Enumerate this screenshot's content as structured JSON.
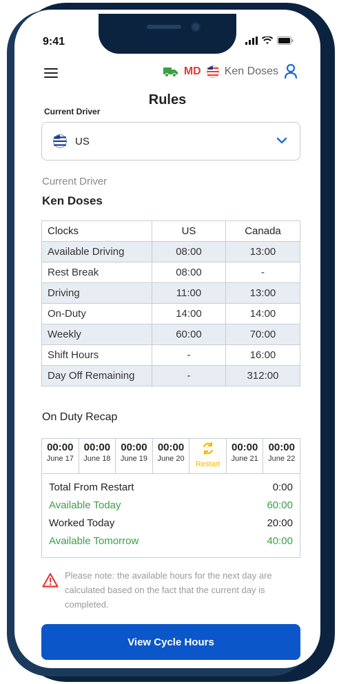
{
  "status_bar": {
    "time": "9:41"
  },
  "header": {
    "md_label": "MD",
    "driver_name": "Ken Doses",
    "title": "Rules"
  },
  "current_driver_label": "Current Driver",
  "select": {
    "value": "US"
  },
  "driver_section": {
    "label": "Current Driver",
    "name": "Ken Doses"
  },
  "clocks_table": {
    "headers": [
      "Clocks",
      "US",
      "Canada"
    ],
    "rows": [
      [
        "Available Driving",
        "08:00",
        "13:00"
      ],
      [
        "Rest Break",
        "08:00",
        "-"
      ],
      [
        "Driving",
        "11:00",
        "13:00"
      ],
      [
        "On-Duty",
        "14:00",
        "14:00"
      ],
      [
        "Weekly",
        "60:00",
        "70:00"
      ],
      [
        "Shift Hours",
        "-",
        "16:00"
      ],
      [
        "Day Off Remaining",
        "-",
        "312:00"
      ]
    ]
  },
  "recap": {
    "title": "On Duty Recap",
    "days": [
      {
        "time": "00:00",
        "date": "June 17"
      },
      {
        "time": "00:00",
        "date": "June 18"
      },
      {
        "time": "00:00",
        "date": "June 19"
      },
      {
        "time": "00:00",
        "date": "June 20"
      },
      {
        "restart_label": "Restart"
      },
      {
        "time": "00:00",
        "date": "June 21"
      },
      {
        "time": "00:00",
        "date": "June 22"
      }
    ],
    "summary": [
      {
        "label": "Total From Restart",
        "value": "0:00"
      },
      {
        "label": "Available Today",
        "value": "60:00"
      },
      {
        "label": "Worked Today",
        "value": "20:00"
      },
      {
        "label": "Available Tomorrow",
        "value": "40:00"
      }
    ]
  },
  "note": "Please note: the available hours for the next day are calculated based on the fact that the current day is completed.",
  "cta": {
    "label": "View Cycle Hours"
  },
  "colors": {
    "primary": "#0b57c9",
    "green": "#3aa047",
    "warning": "#e53935",
    "restart": "#f5b700"
  }
}
